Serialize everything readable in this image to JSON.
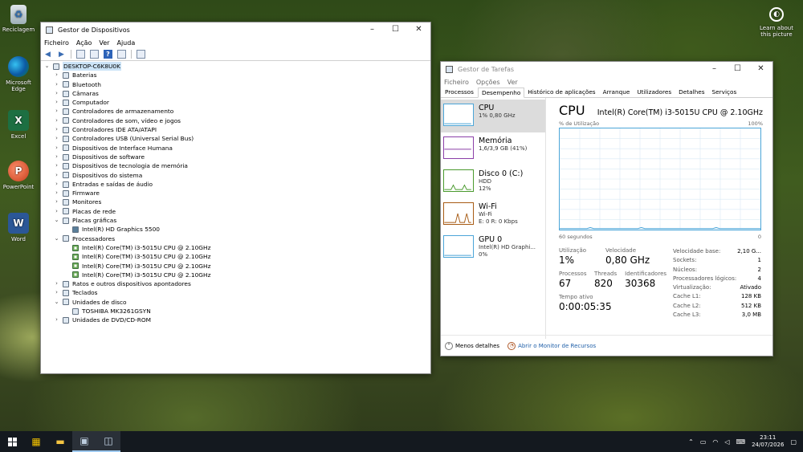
{
  "desktop": {
    "icons": [
      {
        "label": "Reciclagem",
        "icon": "recycle-bin-icon"
      },
      {
        "label": "Microsoft Edge",
        "icon": "edge-icon"
      },
      {
        "label": "Excel",
        "icon": "excel-icon"
      },
      {
        "label": "PowerPoint",
        "icon": "powerpoint-icon"
      },
      {
        "label": "Word",
        "icon": "word-icon"
      }
    ],
    "learn": "Learn about this picture"
  },
  "device_manager": {
    "title": "Gestor de Dispositivos",
    "menu": [
      "Ficheiro",
      "Ação",
      "Ver",
      "Ajuda"
    ],
    "tree": [
      {
        "label": "DESKTOP-C6K8U0K",
        "arrow": "⌄",
        "level": 0,
        "root": true
      },
      {
        "label": "Baterias",
        "arrow": "›",
        "level": 1
      },
      {
        "label": "Bluetooth",
        "arrow": "›",
        "level": 1
      },
      {
        "label": "Câmaras",
        "arrow": "›",
        "level": 1
      },
      {
        "label": "Computador",
        "arrow": "›",
        "level": 1
      },
      {
        "label": "Controladores de armazenamento",
        "arrow": "›",
        "level": 1
      },
      {
        "label": "Controladores de som, vídeo e jogos",
        "arrow": "›",
        "level": 1
      },
      {
        "label": "Controladores IDE ATA/ATAPI",
        "arrow": "›",
        "level": 1
      },
      {
        "label": "Controladores USB (Universal Serial Bus)",
        "arrow": "›",
        "level": 1
      },
      {
        "label": "Dispositivos de Interface Humana",
        "arrow": "›",
        "level": 1
      },
      {
        "label": "Dispositivos de software",
        "arrow": "›",
        "level": 1
      },
      {
        "label": "Dispositivos de tecnologia de memória",
        "arrow": "›",
        "level": 1
      },
      {
        "label": "Dispositivos do sistema",
        "arrow": "›",
        "level": 1
      },
      {
        "label": "Entradas e saídas de áudio",
        "arrow": "›",
        "level": 1
      },
      {
        "label": "Firmware",
        "arrow": "›",
        "level": 1
      },
      {
        "label": "Monitores",
        "arrow": "›",
        "level": 1
      },
      {
        "label": "Placas de rede",
        "arrow": "›",
        "level": 1
      },
      {
        "label": "Placas gráficas",
        "arrow": "⌄",
        "level": 1
      },
      {
        "label": "Intel(R) HD Graphics 5500",
        "arrow": "",
        "level": 2,
        "kind": "gpu"
      },
      {
        "label": "Processadores",
        "arrow": "⌄",
        "level": 1
      },
      {
        "label": "Intel(R) Core(TM) i3-5015U CPU @ 2.10GHz",
        "arrow": "",
        "level": 2,
        "kind": "chip"
      },
      {
        "label": "Intel(R) Core(TM) i3-5015U CPU @ 2.10GHz",
        "arrow": "",
        "level": 2,
        "kind": "chip"
      },
      {
        "label": "Intel(R) Core(TM) i3-5015U CPU @ 2.10GHz",
        "arrow": "",
        "level": 2,
        "kind": "chip"
      },
      {
        "label": "Intel(R) Core(TM) i3-5015U CPU @ 2.10GHz",
        "arrow": "",
        "level": 2,
        "kind": "chip"
      },
      {
        "label": "Ratos e outros dispositivos apontadores",
        "arrow": "›",
        "level": 1
      },
      {
        "label": "Teclados",
        "arrow": "›",
        "level": 1
      },
      {
        "label": "Unidades de disco",
        "arrow": "⌄",
        "level": 1
      },
      {
        "label": "TOSHIBA MK3261GSYN",
        "arrow": "",
        "level": 2
      },
      {
        "label": "Unidades de DVD/CD-ROM",
        "arrow": "›",
        "level": 1
      }
    ]
  },
  "task_manager": {
    "title": "Gestor de Tarefas",
    "menu": [
      "Ficheiro",
      "Opções",
      "Ver"
    ],
    "tabs": [
      "Processos",
      "Desempenho",
      "Histórico de aplicações",
      "Arranque",
      "Utilizadores",
      "Detalhes",
      "Serviços"
    ],
    "active_tab": 1,
    "sidebar": [
      {
        "title": "CPU",
        "l2": "1% 0,80 GHz",
        "l3": "",
        "color": "#4ba5d8",
        "active": true
      },
      {
        "title": "Memória",
        "l2": "1,6/3,9 GB (41%)",
        "l3": "",
        "color": "#8b3fa8"
      },
      {
        "title": "Disco 0 (C:)",
        "l2": "HDD",
        "l3": "12%",
        "color": "#4a9a2e"
      },
      {
        "title": "Wi-Fi",
        "l2": "Wi-Fi",
        "l3": "E: 0 R: 0 Kbps",
        "color": "#a75b14"
      },
      {
        "title": "GPU 0",
        "l2": "Intel(R) HD Graphi...",
        "l3": "0%",
        "color": "#4ba5d8"
      }
    ],
    "cpu": {
      "heading": "CPU",
      "model": "Intel(R) Core(TM) i3-5015U CPU @ 2.10GHz",
      "graph_label": "% de Utilização",
      "graph_max": "100%",
      "graph_time": "60 segundos",
      "graph_min": "0",
      "stats": {
        "util_label": "Utilização",
        "util": "1%",
        "speed_label": "Velocidade",
        "speed": "0,80 GHz",
        "proc_label": "Processos",
        "proc": "67",
        "threads_label": "Threads",
        "threads": "820",
        "handles_label": "Identificadores",
        "handles": "30368",
        "uptime_label": "Tempo ativo",
        "uptime": "0:00:05:35"
      },
      "specs": [
        {
          "k": "Velocidade base:",
          "v": "2,10 G..."
        },
        {
          "k": "Sockets:",
          "v": "1"
        },
        {
          "k": "Núcleos:",
          "v": "2"
        },
        {
          "k": "Processadores lógicos:",
          "v": "4"
        },
        {
          "k": "Virtualização:",
          "v": "Ativado"
        },
        {
          "k": "Cache L1:",
          "v": "128 KB"
        },
        {
          "k": "Cache L2:",
          "v": "512 KB"
        },
        {
          "k": "Cache L3:",
          "v": "3,0 MB"
        }
      ],
      "usage_history": [
        1,
        1,
        1,
        1,
        1,
        1,
        1,
        1,
        1,
        2,
        1,
        1,
        1,
        1,
        1,
        1,
        1,
        1,
        1,
        1,
        1,
        1,
        1,
        1,
        2,
        1,
        1,
        1,
        1,
        1,
        1,
        1,
        1,
        1,
        1,
        1,
        1,
        1,
        1,
        1,
        1,
        1,
        1,
        1,
        1,
        1,
        2,
        1,
        1,
        1,
        1,
        1,
        1,
        1,
        1,
        1,
        1,
        1,
        1,
        1
      ]
    },
    "footer": {
      "less": "Menos detalhes",
      "monitor": "Abrir o Monitor de Recursos"
    }
  },
  "taskbar": {
    "time": "23:11",
    "date": "24/07/2026",
    "apps": [
      "widgets-icon",
      "file-explorer-icon",
      "device-manager-icon",
      "task-manager-icon"
    ]
  }
}
